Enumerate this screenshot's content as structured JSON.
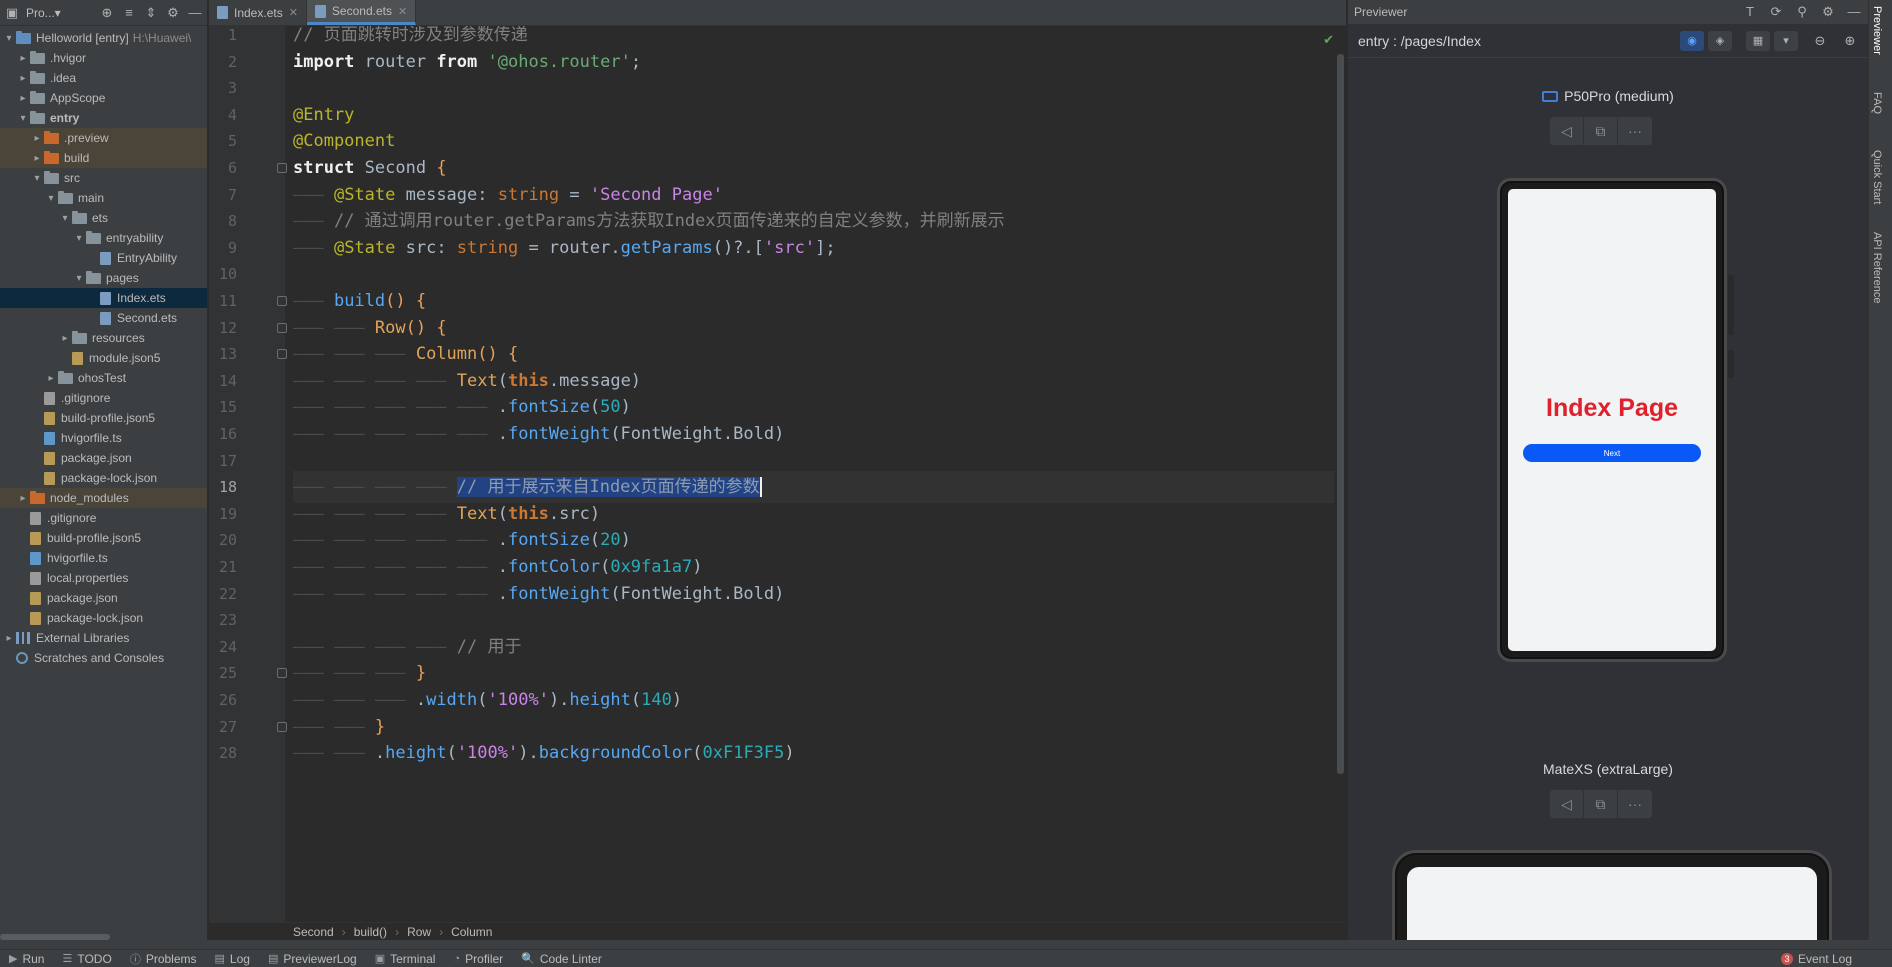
{
  "left_panel": {
    "title": "Pro...▾",
    "tree": [
      {
        "label": "Helloworld [entry]",
        "muted": "H:\\Huawei\\",
        "depth": 0,
        "arrow": "▾",
        "icon": "folder-blue",
        "state": ""
      },
      {
        "label": ".hvigor",
        "depth": 1,
        "arrow": "›",
        "icon": "folder-gray",
        "state": ""
      },
      {
        "label": ".idea",
        "depth": 1,
        "arrow": "›",
        "icon": "folder-gray",
        "state": ""
      },
      {
        "label": "AppScope",
        "depth": 1,
        "arrow": "›",
        "icon": "folder-gray",
        "state": ""
      },
      {
        "label": "entry",
        "depth": 1,
        "arrow": "▾",
        "icon": "folder-gray",
        "state": "",
        "bold": true
      },
      {
        "label": ".preview",
        "depth": 2,
        "arrow": "›",
        "icon": "folder-orange",
        "state": "hl"
      },
      {
        "label": "build",
        "depth": 2,
        "arrow": "›",
        "icon": "folder-orange",
        "state": "hl"
      },
      {
        "label": "src",
        "depth": 2,
        "arrow": "▾",
        "icon": "folder-gray",
        "state": ""
      },
      {
        "label": "main",
        "depth": 3,
        "arrow": "▾",
        "icon": "folder-gray",
        "state": ""
      },
      {
        "label": "ets",
        "depth": 4,
        "arrow": "▾",
        "icon": "folder-gray",
        "state": ""
      },
      {
        "label": "entryability",
        "depth": 5,
        "arrow": "▾",
        "icon": "folder-gray",
        "state": ""
      },
      {
        "label": "EntryAbility",
        "depth": 6,
        "arrow": "",
        "icon": "file-ets",
        "state": ""
      },
      {
        "label": "pages",
        "depth": 5,
        "arrow": "▾",
        "icon": "folder-gray",
        "state": ""
      },
      {
        "label": "Index.ets",
        "depth": 6,
        "arrow": "",
        "icon": "file-ets",
        "state": "sel"
      },
      {
        "label": "Second.ets",
        "depth": 6,
        "arrow": "",
        "icon": "file-ets",
        "state": ""
      },
      {
        "label": "resources",
        "depth": 4,
        "arrow": "›",
        "icon": "folder-gray",
        "state": ""
      },
      {
        "label": "module.json5",
        "depth": 4,
        "arrow": "",
        "icon": "file-json",
        "state": ""
      },
      {
        "label": "ohosTest",
        "depth": 3,
        "arrow": "›",
        "icon": "folder-gray",
        "state": ""
      },
      {
        "label": ".gitignore",
        "depth": 2,
        "arrow": "",
        "icon": "file-gen",
        "state": ""
      },
      {
        "label": "build-profile.json5",
        "depth": 2,
        "arrow": "",
        "icon": "file-json",
        "state": ""
      },
      {
        "label": "hvigorfile.ts",
        "depth": 2,
        "arrow": "",
        "icon": "file-ts",
        "state": ""
      },
      {
        "label": "package.json",
        "depth": 2,
        "arrow": "",
        "icon": "file-json",
        "state": ""
      },
      {
        "label": "package-lock.json",
        "depth": 2,
        "arrow": "",
        "icon": "file-json",
        "state": ""
      },
      {
        "label": "node_modules",
        "depth": 1,
        "arrow": "›",
        "icon": "folder-orange",
        "state": "hl"
      },
      {
        "label": ".gitignore",
        "depth": 1,
        "arrow": "",
        "icon": "file-gen",
        "state": ""
      },
      {
        "label": "build-profile.json5",
        "depth": 1,
        "arrow": "",
        "icon": "file-json",
        "state": ""
      },
      {
        "label": "hvigorfile.ts",
        "depth": 1,
        "arrow": "",
        "icon": "file-ts",
        "state": ""
      },
      {
        "label": "local.properties",
        "depth": 1,
        "arrow": "",
        "icon": "file-gen",
        "state": ""
      },
      {
        "label": "package.json",
        "depth": 1,
        "arrow": "",
        "icon": "file-json",
        "state": ""
      },
      {
        "label": "package-lock.json",
        "depth": 1,
        "arrow": "",
        "icon": "file-json",
        "state": ""
      },
      {
        "label": "External Libraries",
        "depth": 0,
        "arrow": "›",
        "icon": "library",
        "state": ""
      },
      {
        "label": "Scratches and Consoles",
        "depth": 0,
        "arrow": "",
        "icon": "scratch",
        "state": ""
      }
    ]
  },
  "editor": {
    "tabs": [
      {
        "label": "Index.ets",
        "active": false
      },
      {
        "label": "Second.ets",
        "active": true
      }
    ],
    "current_line": 18,
    "lines": [
      {
        "n": 1,
        "indent": 0,
        "segs": [
          [
            "cmt",
            "// 页面跳转时涉及到参数传递"
          ]
        ]
      },
      {
        "n": 2,
        "indent": 0,
        "segs": [
          [
            "kwb",
            "import"
          ],
          [
            "",
            " router "
          ],
          [
            "kwb",
            "from"
          ],
          [
            "",
            " "
          ],
          [
            "str",
            "'@ohos.router'"
          ],
          [
            "",
            ";"
          ]
        ]
      },
      {
        "n": 3,
        "indent": 0,
        "segs": []
      },
      {
        "n": 4,
        "indent": 0,
        "segs": [
          [
            "ann",
            "@Entry"
          ]
        ]
      },
      {
        "n": 5,
        "indent": 0,
        "segs": [
          [
            "ann",
            "@Component"
          ]
        ]
      },
      {
        "n": 6,
        "indent": 0,
        "segs": [
          [
            "kwb",
            "struct"
          ],
          [
            "",
            " "
          ],
          [
            "struct-name",
            "Second"
          ],
          [
            "",
            " "
          ],
          [
            "orange",
            "{"
          ]
        ]
      },
      {
        "n": 7,
        "indent": 1,
        "segs": [
          [
            "ann",
            "@State"
          ],
          [
            "",
            " message: "
          ],
          [
            "typ",
            "string"
          ],
          [
            "",
            " = "
          ],
          [
            "strp",
            "'Second Page'"
          ]
        ]
      },
      {
        "n": 8,
        "indent": 1,
        "segs": [
          [
            "cmt",
            "// 通过调用router.getParams方法获取Index页面传递来的自定义参数，并刷新展示"
          ]
        ]
      },
      {
        "n": 9,
        "indent": 1,
        "segs": [
          [
            "ann",
            "@State"
          ],
          [
            "",
            " src: "
          ],
          [
            "typ",
            "string"
          ],
          [
            "",
            " = router."
          ],
          [
            "fn",
            "getParams"
          ],
          [
            "",
            "()?.["
          ],
          [
            "strp",
            "'src'"
          ],
          [
            "",
            "];"
          ]
        ]
      },
      {
        "n": 10,
        "indent": 0,
        "segs": []
      },
      {
        "n": 11,
        "indent": 1,
        "segs": [
          [
            "fn",
            "build"
          ],
          [
            "orange",
            "()"
          ],
          [
            "",
            " "
          ],
          [
            "orange",
            "{"
          ]
        ]
      },
      {
        "n": 12,
        "indent": 2,
        "segs": [
          [
            "comp",
            "Row"
          ],
          [
            "orange",
            "()"
          ],
          [
            "",
            " "
          ],
          [
            "orange",
            "{"
          ]
        ]
      },
      {
        "n": 13,
        "indent": 3,
        "segs": [
          [
            "comp",
            "Column"
          ],
          [
            "orange",
            "()"
          ],
          [
            "",
            " "
          ],
          [
            "orange",
            "{"
          ]
        ]
      },
      {
        "n": 14,
        "indent": 4,
        "segs": [
          [
            "comp",
            "Text"
          ],
          [
            "",
            "("
          ],
          [
            "this",
            "this"
          ],
          [
            "",
            ".message)"
          ]
        ]
      },
      {
        "n": 15,
        "indent": 5,
        "segs": [
          [
            "",
            "."
          ],
          [
            "fn",
            "fontSize"
          ],
          [
            "",
            "("
          ],
          [
            "num",
            "50"
          ],
          [
            "",
            ")"
          ]
        ]
      },
      {
        "n": 16,
        "indent": 5,
        "segs": [
          [
            "",
            "."
          ],
          [
            "fn",
            "fontWeight"
          ],
          [
            "",
            "(FontWeight.Bold)"
          ]
        ]
      },
      {
        "n": 17,
        "indent": 0,
        "segs": []
      },
      {
        "n": 18,
        "indent": 4,
        "segs": [
          [
            "sel-text",
            "// 用于展示来自Index页面传递的参数"
          ]
        ],
        "caret": true
      },
      {
        "n": 19,
        "indent": 4,
        "segs": [
          [
            "comp",
            "Text"
          ],
          [
            "",
            "("
          ],
          [
            "this",
            "this"
          ],
          [
            "",
            ".src)"
          ]
        ]
      },
      {
        "n": 20,
        "indent": 5,
        "segs": [
          [
            "",
            "."
          ],
          [
            "fn",
            "fontSize"
          ],
          [
            "",
            "("
          ],
          [
            "num",
            "20"
          ],
          [
            "",
            ")"
          ]
        ]
      },
      {
        "n": 21,
        "indent": 5,
        "segs": [
          [
            "",
            "."
          ],
          [
            "fn",
            "fontColor"
          ],
          [
            "",
            "("
          ],
          [
            "num",
            "0x9fa1a7"
          ],
          [
            "",
            ")"
          ]
        ]
      },
      {
        "n": 22,
        "indent": 5,
        "segs": [
          [
            "",
            "."
          ],
          [
            "fn",
            "fontWeight"
          ],
          [
            "",
            "(FontWeight.Bold)"
          ]
        ]
      },
      {
        "n": 23,
        "indent": 0,
        "segs": []
      },
      {
        "n": 24,
        "indent": 4,
        "segs": [
          [
            "cmt",
            "// 用于"
          ]
        ]
      },
      {
        "n": 25,
        "indent": 3,
        "segs": [
          [
            "orange",
            "}"
          ]
        ]
      },
      {
        "n": 26,
        "indent": 3,
        "segs": [
          [
            "",
            "."
          ],
          [
            "fn",
            "width"
          ],
          [
            "",
            "("
          ],
          [
            "strp",
            "'100%'"
          ],
          [
            "",
            ")."
          ],
          [
            "fn",
            "height"
          ],
          [
            "",
            "("
          ],
          [
            "num",
            "140"
          ],
          [
            "",
            ")"
          ]
        ]
      },
      {
        "n": 27,
        "indent": 2,
        "segs": [
          [
            "orange",
            "}"
          ]
        ]
      },
      {
        "n": 28,
        "indent": 2,
        "segs": [
          [
            "",
            "."
          ],
          [
            "fn",
            "height"
          ],
          [
            "",
            "("
          ],
          [
            "strp",
            "'100%'"
          ],
          [
            "",
            ")."
          ],
          [
            "fn",
            "backgroundColor"
          ],
          [
            "",
            "("
          ],
          [
            "num",
            "0xF1F3F5"
          ],
          [
            "",
            ")"
          ]
        ]
      }
    ],
    "breadcrumb": [
      "Second",
      "build()",
      "Row",
      "Column"
    ]
  },
  "previewer": {
    "title": "Previewer",
    "route": "entry : /pages/Index",
    "devices": [
      {
        "name": "P50Pro (medium)",
        "page_title": "Index Page",
        "button_label": "Next"
      },
      {
        "name": "MateXS (extraLarge)"
      }
    ],
    "side_tabs": [
      "Previewer",
      "FAQ",
      "Quick Start",
      "API Reference"
    ]
  },
  "bottom_bar": {
    "items": [
      "Run",
      "TODO",
      "Problems",
      "Log",
      "PreviewerLog",
      "Terminal",
      "Profiler",
      "Code Linter"
    ],
    "event_log": "Event Log",
    "event_count": "3"
  },
  "colors": {
    "accent": "#4a88c7",
    "selection": "#214283",
    "next_button": "#0a59f7",
    "index_title": "#e0202b"
  }
}
